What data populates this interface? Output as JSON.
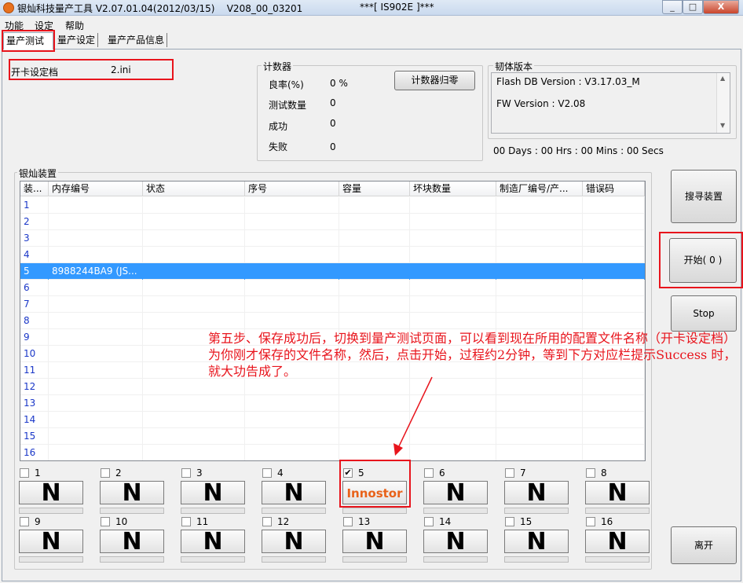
{
  "window": {
    "title": "银灿科技量产工具 V2.07.01.04(2012/03/15)",
    "build": "V208_00_03201",
    "model": "***[ IS902E ]***",
    "minimize": "_",
    "maximize": "□",
    "close": "X"
  },
  "menu": [
    "功能",
    "设定",
    "帮助"
  ],
  "tabs": [
    "量产测试",
    "量产设定",
    "量产产品信息"
  ],
  "config": {
    "label": "开卡设定档",
    "value": "2.ini"
  },
  "counter": {
    "title": "计数器",
    "rate_label": "良率(%)",
    "rate_value": "0 %",
    "tested_label": "测试数量",
    "tested_value": "0",
    "success_label": "成功",
    "success_value": "0",
    "fail_label": "失败",
    "fail_value": "0",
    "reset_button": "计数器归零"
  },
  "firmware": {
    "title": "韧体版本",
    "flash_db": "Flash DB Version :  V3.17.03_M",
    "fw": "FW Version :   V2.08",
    "timer": "00 Days : 00 Hrs : 00 Mins : 00 Secs"
  },
  "devices": {
    "title": "银灿装置",
    "columns": [
      "装...",
      "内存编号",
      "状态",
      "序号",
      "容量",
      "坏块数量",
      "制造厂编号/产...",
      "错误码"
    ],
    "rows": [
      {
        "no": "1",
        "mem": ""
      },
      {
        "no": "2",
        "mem": ""
      },
      {
        "no": "3",
        "mem": ""
      },
      {
        "no": "4",
        "mem": ""
      },
      {
        "no": "5",
        "mem": "8988244BA9 (JS..."
      },
      {
        "no": "6",
        "mem": ""
      },
      {
        "no": "7",
        "mem": ""
      },
      {
        "no": "8",
        "mem": ""
      },
      {
        "no": "9",
        "mem": ""
      },
      {
        "no": "10",
        "mem": ""
      },
      {
        "no": "11",
        "mem": ""
      },
      {
        "no": "12",
        "mem": ""
      },
      {
        "no": "13",
        "mem": ""
      },
      {
        "no": "14",
        "mem": ""
      },
      {
        "no": "15",
        "mem": ""
      },
      {
        "no": "16",
        "mem": ""
      }
    ],
    "selected_row": "5"
  },
  "buttons": {
    "search": "搜寻装置",
    "start": "开始( 0 )",
    "stop": "Stop",
    "exit": "离开"
  },
  "slots": [
    {
      "num": "1",
      "label": "N",
      "checked": false
    },
    {
      "num": "2",
      "label": "N",
      "checked": false
    },
    {
      "num": "3",
      "label": "N",
      "checked": false
    },
    {
      "num": "4",
      "label": "N",
      "checked": false
    },
    {
      "num": "5",
      "label": "Innostor",
      "checked": true
    },
    {
      "num": "6",
      "label": "N",
      "checked": false
    },
    {
      "num": "7",
      "label": "N",
      "checked": false
    },
    {
      "num": "8",
      "label": "N",
      "checked": false
    },
    {
      "num": "9",
      "label": "N",
      "checked": false
    },
    {
      "num": "10",
      "label": "N",
      "checked": false
    },
    {
      "num": "11",
      "label": "N",
      "checked": false
    },
    {
      "num": "12",
      "label": "N",
      "checked": false
    },
    {
      "num": "13",
      "label": "N",
      "checked": false
    },
    {
      "num": "14",
      "label": "N",
      "checked": false
    },
    {
      "num": "15",
      "label": "N",
      "checked": false
    },
    {
      "num": "16",
      "label": "N",
      "checked": false
    }
  ],
  "annotation": "第五步、保存成功后，切换到量产测试页面，可以看到现在所用的配置文件名称（开卡设定档）为你刚才保存的文件名称，然后，点击开始，过程约2分钟，等到下方对应栏提示Success 时，就大功告成了。",
  "colors": {
    "highlight": "#e8141c",
    "selection": "#3399ff",
    "brand": "#e8621a"
  }
}
